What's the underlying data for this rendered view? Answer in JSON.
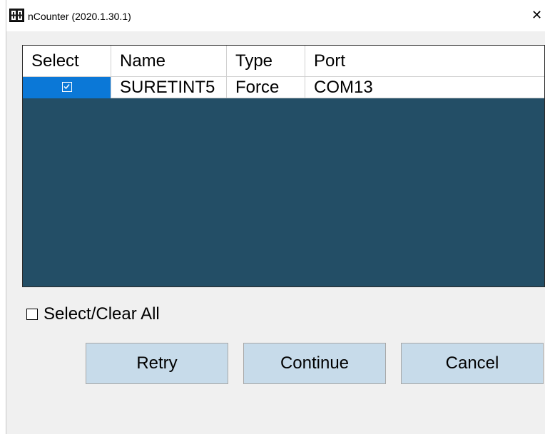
{
  "window": {
    "title": "nCounter (2020.1.30.1)",
    "close_glyph": "✕",
    "app_icon": "ncounter-app-icon"
  },
  "device_list": {
    "columns": [
      "Select",
      "Name",
      "Type",
      "Port"
    ],
    "rows": [
      {
        "selected": true,
        "name": "SURETINT5",
        "type": "Force",
        "port": "COM13"
      }
    ]
  },
  "select_all": {
    "label": "Select/Clear All",
    "checked": false
  },
  "buttons": {
    "retry": "Retry",
    "continue": "Continue",
    "cancel": "Cancel"
  },
  "colors": {
    "list_background": "#234e66",
    "row_highlight": "#0b78d7",
    "button_face": "#c7dbea"
  }
}
